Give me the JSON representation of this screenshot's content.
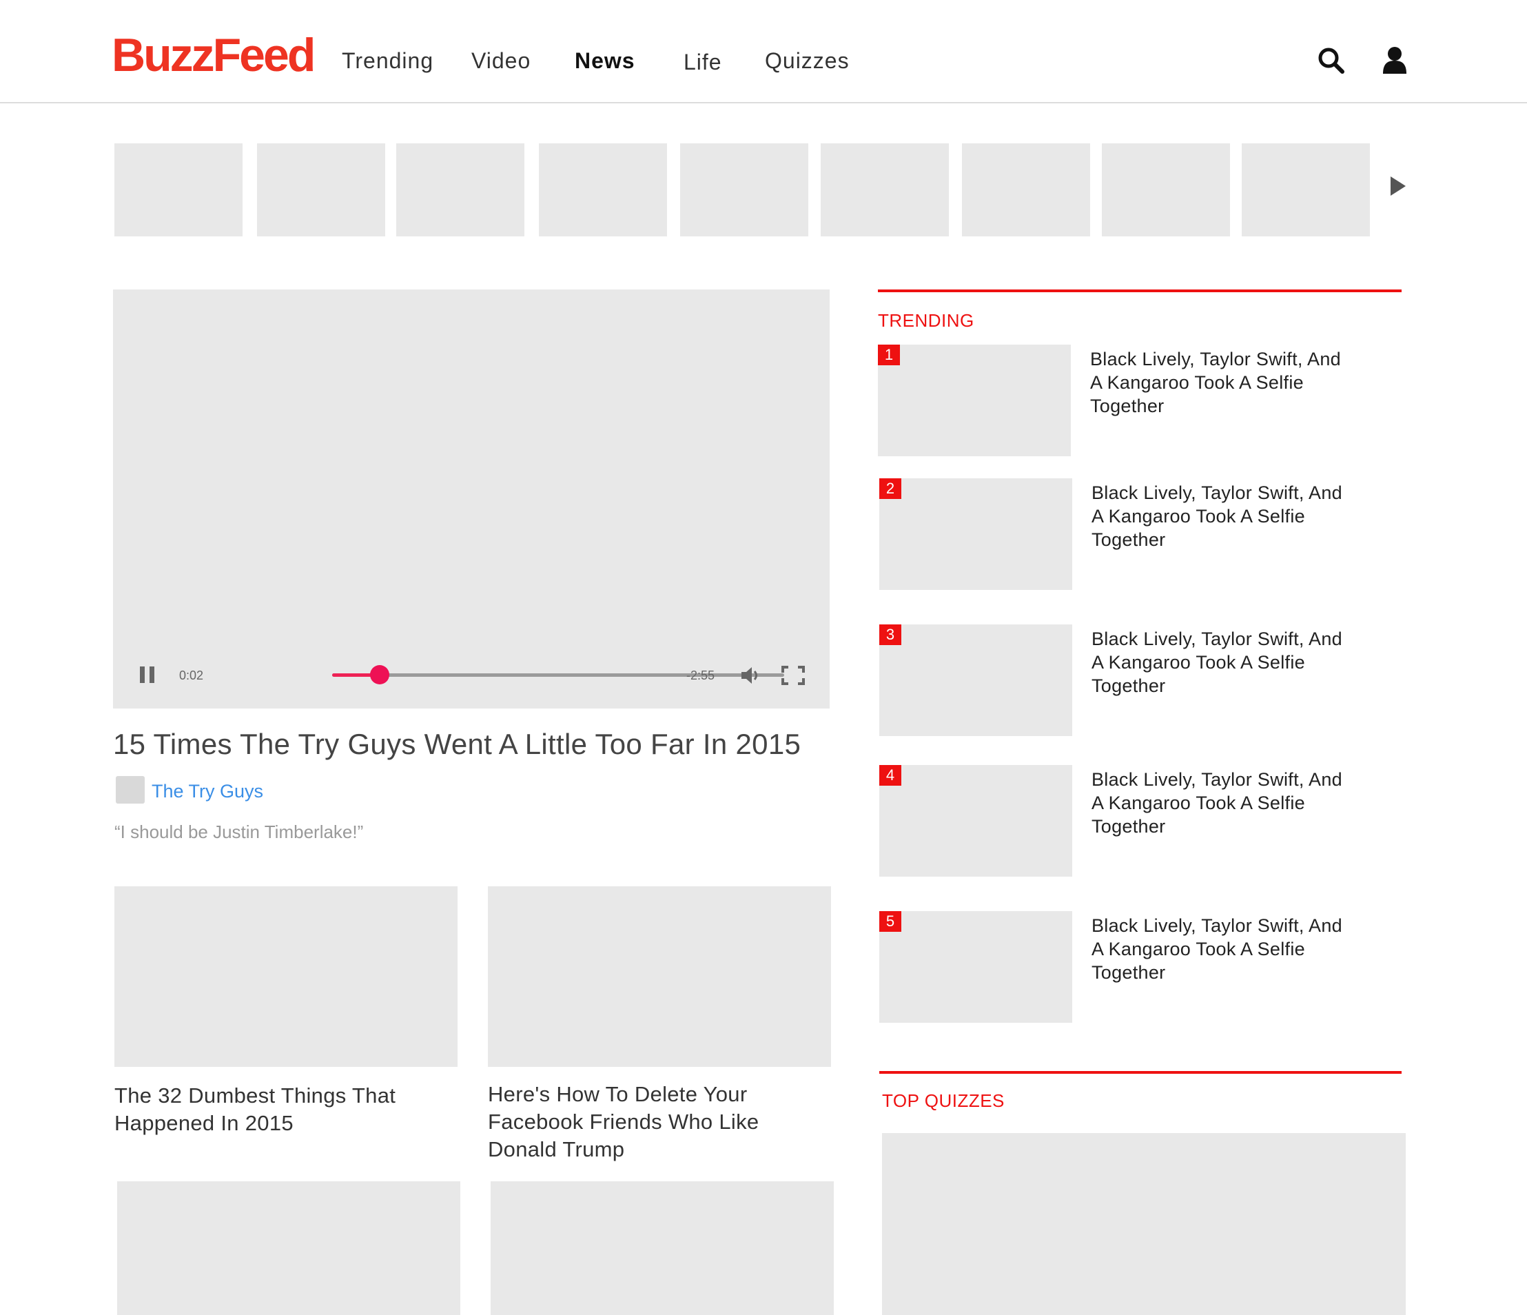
{
  "header": {
    "logo": "BuzzFeed",
    "nav": [
      "Trending",
      "Video",
      "News",
      "Life",
      "Quizzes"
    ],
    "search_icon": "search-icon",
    "user_icon": "user-icon"
  },
  "video": {
    "current_time": "0:02",
    "remaining_time": "-2:55",
    "progress": 0.105,
    "title": "15 Times The Try Guys Went A Little Too Far In 2015",
    "author": "The Try Guys",
    "quote": "“I should be Justin Timberlake!”"
  },
  "cards": [
    {
      "title_lines": [
        "The 32 Dumbest Things That",
        "Happened In 2015"
      ]
    },
    {
      "title_lines": [
        "Here's How To Delete Your",
        "Facebook Friends Who Like",
        "Donald Trump"
      ]
    }
  ],
  "sidebar": {
    "trending_title": "TRENDING",
    "trending": [
      {
        "num": "1",
        "title_lines": [
          "Black Lively, Taylor Swift, And",
          "A Kangaroo Took A Selfie",
          "Together"
        ]
      },
      {
        "num": "2",
        "title_lines": [
          "Black Lively, Taylor Swift, And",
          "A Kangaroo Took A Selfie",
          "Together"
        ]
      },
      {
        "num": "3",
        "title_lines": [
          "Black Lively, Taylor Swift, And",
          "A Kangaroo Took A Selfie",
          "Together"
        ]
      },
      {
        "num": "4",
        "title_lines": [
          "Black Lively, Taylor Swift, And",
          "A Kangaroo Took A Selfie",
          "Together"
        ]
      },
      {
        "num": "5",
        "title_lines": [
          "Black Lively, Taylor Swift, And",
          "A Kangaroo Took A Selfie",
          "Together"
        ]
      }
    ],
    "quizzes_title": "TOP QUIZZES"
  },
  "colors": {
    "brand": "#ee3322",
    "accent_red": "#ee1111",
    "seek": "#ee1155",
    "link": "#3a8ee6"
  }
}
